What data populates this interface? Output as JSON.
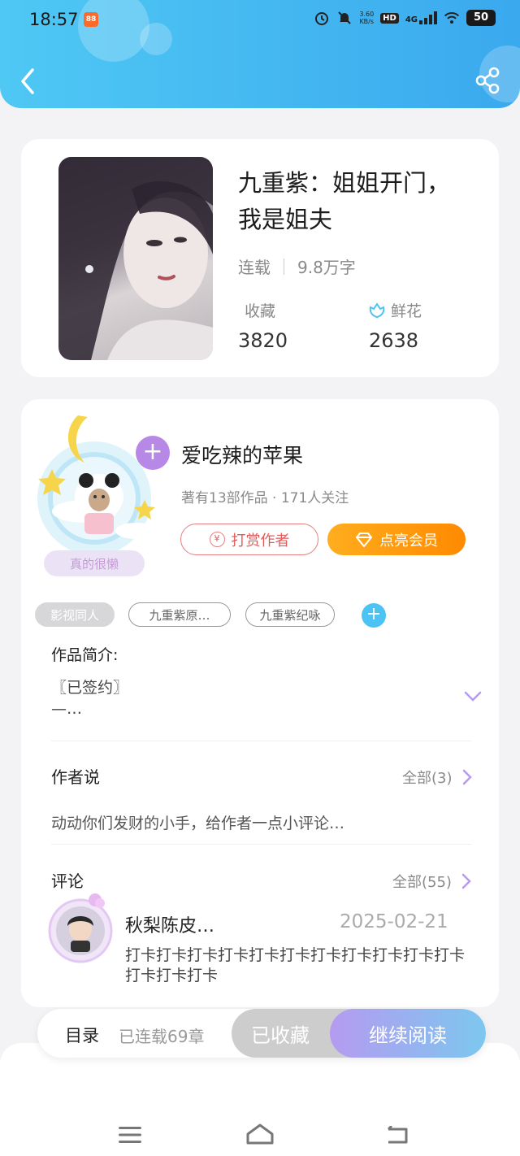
{
  "status_bar": {
    "time": "18:57",
    "app_badge": "88",
    "net_speed_value": "3.60",
    "net_speed_unit": "KB/s",
    "hd_label": "HD",
    "signal_label": "4G",
    "battery": "50"
  },
  "colors": {
    "header_start": "#4fc8f4",
    "header_end": "#3aa9ee",
    "reward": "#e25b5b",
    "vip": "#ff9a10",
    "accent_purple": "#b59bf0",
    "accent_blue": "#4cc3f3"
  },
  "icons": {
    "back": "chevron-left-icon",
    "share": "share-icon",
    "flower": "flower-icon",
    "yen": "yen-coin-icon",
    "diamond": "diamond-icon",
    "expand": "chevron-down-icon",
    "more": "chevron-right-icon"
  },
  "book": {
    "title": "九重紫：姐姐开门，我是姐夫",
    "status": "连载",
    "word_count": "9.8万字",
    "favorites_label": "收藏",
    "favorites_count": "3820",
    "flowers_label": "鲜花",
    "flowers_count": "2638"
  },
  "author": {
    "avatar_caption": "真的很懒",
    "name": "爱吃辣的苹果",
    "meta": "著有13部作品 · 171人关注",
    "reward_label": "打赏作者",
    "vip_label": "点亮会员"
  },
  "tags": [
    {
      "label": "影视同人"
    },
    {
      "label": "九重紫原…"
    },
    {
      "label": "九重紫纪咏"
    }
  ],
  "intro": {
    "title": "作品简介:",
    "line1": "〖已签约〗",
    "line2": "—…"
  },
  "author_says": {
    "title": "作者说",
    "all_label": "全部(3)",
    "text": "动动你们发财的小手，给作者一点小评论…"
  },
  "comments": {
    "title": "评论",
    "all_label": "全部(55)",
    "items": [
      {
        "user": "秋梨陈皮…",
        "date": "2025-02-21",
        "text": "打卡打卡打卡打卡打卡打卡打卡打卡打卡打卡打卡打卡打卡打卡"
      }
    ]
  },
  "bottom_bar": {
    "toc_label": "目录",
    "toc_info": "已连载69章",
    "favorited_label": "已收藏",
    "continue_label": "继续阅读"
  }
}
